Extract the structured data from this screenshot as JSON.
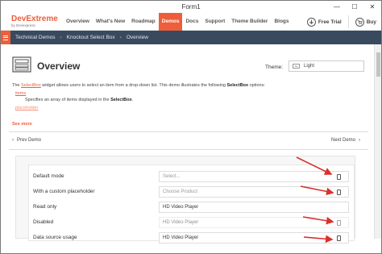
{
  "window": {
    "title": "Form1",
    "minimize": "—",
    "maximize": "☐",
    "close": "✕"
  },
  "header": {
    "logo_main": "DevExtreme",
    "logo_sub": "by Devexpress",
    "nav": [
      "Overview",
      "What's New",
      "Roadmap",
      "Demos",
      "Docs",
      "Support",
      "Theme Builder",
      "Blogs"
    ],
    "active_nav": "Demos",
    "free_trial": "Free Trial",
    "buy": "Buy"
  },
  "breadcrumb": [
    "Technical Demos",
    "Knockout Select Box",
    "Overview"
  ],
  "page": {
    "title": "Overview",
    "theme_label": "Theme:",
    "theme_value": "Light",
    "desc_pre": "The ",
    "desc_link": "SelectBox",
    "desc_post": " widget allows users to select an item from a drop-down list. This demo illustrates the following ",
    "desc_bold": "SelectBox",
    "desc_end": " options:",
    "option1": "items",
    "option1_desc_pre": "Specifies an array of items displayed in the ",
    "option1_desc_bold": "SelectBox",
    "option1_desc_end": ".",
    "option2": "placeholder",
    "see_more": "See more",
    "prev_demo": "Prev Demo",
    "next_demo": "Next Demo"
  },
  "demo_rows": [
    {
      "label": "Default mode",
      "value": "Select...",
      "placeholder": true,
      "disabled": false
    },
    {
      "label": "With a custom placeholder",
      "value": "Choose Product",
      "placeholder": true,
      "disabled": false
    },
    {
      "label": "Read only",
      "value": "HD Video Player",
      "placeholder": false,
      "disabled": false
    },
    {
      "label": "Disabled",
      "value": "HD Video Player",
      "placeholder": false,
      "disabled": true
    },
    {
      "label": "Data source usage",
      "value": "HD Video Player",
      "placeholder": false,
      "disabled": false
    }
  ],
  "colors": {
    "brand": "#ee5e3a",
    "crumb_bar": "#3a4a5e",
    "arrow": "#d9302c"
  }
}
